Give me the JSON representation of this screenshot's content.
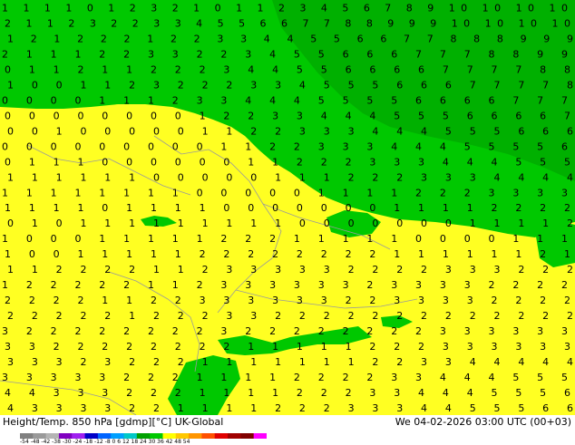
{
  "footer": {
    "title": "Height/Temp. 850 hPa [gdmp][°C] UK-Global",
    "datetime": "We 04-02-2026 03:00 UTC (00+03)"
  },
  "colorbar": {
    "ticks": "-54 -48 -42 -38 -30 -24 -18 -12 -8  0  6  12  18  24  30  36  42  48  54",
    "colors": [
      "#808080",
      "#9a9a9a",
      "#b4b4b4",
      "#8000c0",
      "#a020f0",
      "#0000c8",
      "#0064ff",
      "#00a0ff",
      "#00c8c8",
      "#00a000",
      "#00c800",
      "#ffff00",
      "#ffc800",
      "#ff9600",
      "#ff5000",
      "#e00000",
      "#a00000",
      "#800000",
      "#ff00ff"
    ]
  },
  "map": {
    "colors": {
      "dark_green": "#00b400",
      "mid_green": "#00c800",
      "yellow": "#ffff22",
      "contour": "#000000",
      "border": "#9a9a9a"
    },
    "label_rows": [
      "1 1 1 1 0 1 2 3 2 1 0 1 1 2 3 4 5 6 7 8 9 10 10 10 10",
      "2 1 1 2 3 2 2 3 3 4 5 5 6 6 7 7 8 8 9 9 9 10 10 10 10",
      "1 2 1 2 2 2 1 2 2 3 3 4 4 5 5 6 6 7 7 8 8 8 9 9 9",
      "2 1 1 1 2 2 3 3 2 2 3 4 5 5 6 6 6 7 7 7 8 8 9 9",
      "0 1 1 2 1 1 2 2 2 3 4 4 5 5 6 6 6 6 7 7 7 7 8 8",
      "1 0 0 1 1 2 3 2 2 2 3 3 4 5 5 5 6 6 6 7 7 7 7 8",
      "0 0 0 0 1 1 1 2 3 3 4 4 4 5 5 5 5 6 6 6 6 7 7 7",
      "0 0 0 0 0 0 0 0 1 2 2 3 3 4 4 4 5 5 5 6 6 6 6 7",
      "0 0 1 0 0 0 0 0 1 1 2 2 3 3 3 4 4 4 5 5 5 6 6 6",
      "0 0 0 0 0 0 0 0 0 1 1 2 2 3 3 3 4 4 4 5 5 5 5 6",
      "0 1 1 1 0 0 0 0 0 0 1 1 2 2 2 3 3 3 4 4 4 5 5 5",
      "1 1 1 1 1 1 0 0 0 0 0 1 1 1 2 2 2 3 3 3 4 4 4 4",
      "1 1 1 1 1 1 1 1 0 0 0 0 0 1 1 1 1 2 2 2 3 3 3 3",
      "1 1 1 1 0 1 1 1 1 0 0 0 0 0 0 0 1 1 1 1 2 2 2 2",
      "0 1 0 1 1 1 1 1 1 1 1 1 0 0 0 0 0 0 0 1 1 1 1 2",
      "1 0 0 0 1 1 1 1 1 2 2 2 1 1 1 1 1 0 0 0 0 1 1 1",
      "1 0 0 1 1 1 1 1 2 2 2 2 2 2 2 2 1 1 1 1 1 1 2 1",
      "1 1 2 2 2 2 1 1 2 3 3 3 3 3 2 2 2 2 3 3 3 2 2 2",
      "1 2 2 2 2 2 1 1 2 3 3 3 3 3 3 2 3 3 3 3 2 2 2 2",
      "2 2 2 2 1 1 2 2 3 3 3 3 3 3 2 2 3 3 3 3 2 2 2 2",
      "2 2 2 2 2 1 2 2 2 3 3 2 2 2 2 2 2 2 2 2 2 2 2 2",
      "3 2 2 2 2 2 2 2 2 3 2 2 2 2 2 2 2 2 3 3 3 3 3 3",
      "3 3 2 2 2 2 2 2 2 2 1 1 1 1 1 2 2 2 3 3 3 3 3 3",
      "3 3 3 2 3 2 2 2 1 1 1 1 1 1 1 2 2 3 3 4 4 4 4 4",
      "3 3 3 3 3 2 2 2 1 1 1 1 2 2 2 2 3 3 4 4 4 5 5 5",
      "4 4 3 3 3 2 2 2 1 1 1 1 2 2 2 3 3 4 4 4 5 5 5 6",
      "4 3 3 3 3 2 2 1 1 1 1 2 2 2 3 3 3 4 4 5 5 5 6 6"
    ]
  }
}
